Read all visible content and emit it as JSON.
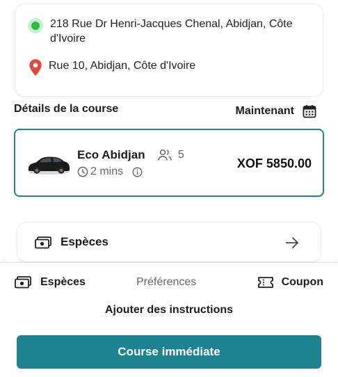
{
  "addresses": {
    "pickup": "218 Rue Dr Henri-Jacques Chenal, Abidjan, Côte d'Ivoire",
    "dropoff": "Rue 10, Abidjan, Côte d'Ivoire"
  },
  "details": {
    "title": "Détails de la course",
    "when": "Maintenant"
  },
  "ride": {
    "name": "Eco Abidjan",
    "seats": "5",
    "eta": "2 mins",
    "price": "XOF 5850.00"
  },
  "payment": {
    "method": "Espèces"
  },
  "bottom": {
    "cash": "Espèces",
    "preferences": "Préférences",
    "coupon": "Coupon",
    "instructions": "Ajouter des instructions",
    "cta": "Course immédiate"
  },
  "colors": {
    "accent": "#1d8390",
    "pickup": "#2bbd3f",
    "dropoff": "#e8473b"
  },
  "icons": {
    "pickup": "pickup-dot-icon",
    "dropoff": "map-pin-icon",
    "calendar": "calendar-icon",
    "car": "car-icon",
    "people": "people-icon",
    "clock": "clock-icon",
    "info": "info-icon",
    "cash": "cash-icon",
    "arrow": "arrow-right-icon",
    "coupon": "ticket-icon"
  }
}
